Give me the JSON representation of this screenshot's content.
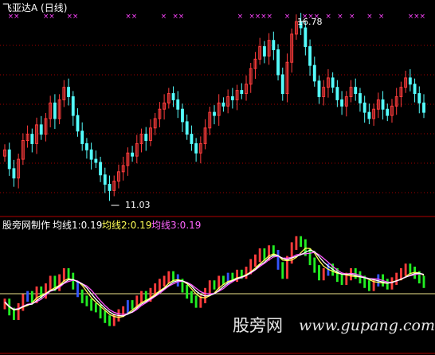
{
  "title": "飞亚达A (日线)",
  "indicator": {
    "name": "股旁网制作",
    "ma1": "均线1:0.19",
    "ma2": "均线2:0.19",
    "ma3": "均线3:0.19"
  },
  "annotations": {
    "high": "16.78",
    "low": "11.03"
  },
  "watermark": {
    "text": "股旁网",
    "url": "www.gupang.com"
  },
  "colors": {
    "background": "#000000",
    "up": "#ff3c3c",
    "down": "#54fcfc",
    "grid": "#a00000",
    "ma1": "#ffffff",
    "ma2": "#ffff55",
    "ma3": "#ff55ff",
    "baseline": "#f0e68c",
    "osc_green": "#22ee22",
    "osc_blue": "#3355ff",
    "marker": "#ff44ff"
  },
  "chart_data": {
    "type": "candlestick",
    "price_range": [
      11.03,
      16.78
    ],
    "close": [
      12.6,
      12.0,
      11.7,
      12.3,
      12.9,
      13.1,
      12.8,
      13.4,
      13.1,
      13.6,
      14.1,
      13.6,
      14.2,
      14.6,
      14.3,
      13.7,
      13.2,
      12.8,
      12.6,
      12.3,
      12.2,
      11.8,
      11.5,
      11.3,
      11.6,
      11.9,
      12.1,
      12.5,
      12.4,
      12.8,
      13.1,
      12.9,
      13.3,
      13.6,
      13.9,
      14.1,
      14.4,
      14.2,
      13.9,
      13.5,
      13.1,
      12.8,
      12.5,
      12.8,
      13.3,
      13.8,
      13.7,
      14.1,
      14.0,
      14.3,
      14.2,
      14.5,
      14.4,
      14.7,
      15.2,
      15.5,
      15.9,
      15.6,
      16.1,
      15.8,
      15.0,
      14.4,
      15.4,
      16.3,
      16.7,
      16.5,
      15.9,
      15.3,
      14.8,
      14.3,
      14.6,
      14.9,
      14.6,
      14.2,
      14.0,
      14.3,
      14.6,
      14.4,
      14.1,
      13.8,
      13.6,
      13.9,
      14.2,
      13.9,
      13.7,
      14.0,
      14.3,
      14.6,
      14.9,
      14.7,
      14.4,
      14.1,
      13.8
    ],
    "open": [
      12.4,
      12.6,
      12.0,
      11.7,
      12.3,
      12.9,
      13.1,
      12.8,
      13.4,
      13.1,
      13.6,
      14.1,
      13.6,
      14.2,
      14.6,
      14.3,
      13.7,
      13.2,
      12.8,
      12.6,
      12.3,
      12.2,
      11.8,
      11.5,
      11.3,
      11.6,
      11.9,
      12.1,
      12.5,
      12.4,
      12.8,
      13.1,
      12.9,
      13.3,
      13.6,
      13.9,
      14.1,
      14.4,
      14.2,
      13.9,
      13.5,
      13.1,
      12.8,
      12.5,
      12.8,
      13.3,
      13.8,
      13.7,
      14.1,
      14.0,
      14.3,
      14.2,
      14.5,
      14.4,
      14.7,
      15.2,
      15.5,
      15.9,
      15.6,
      16.1,
      15.8,
      15.0,
      14.4,
      15.4,
      16.3,
      16.7,
      16.5,
      15.9,
      15.3,
      14.8,
      14.3,
      14.6,
      14.9,
      14.6,
      14.2,
      14.0,
      14.3,
      14.6,
      14.4,
      14.1,
      13.8,
      13.6,
      13.9,
      14.2,
      13.9,
      13.7,
      14.0,
      14.3,
      14.6,
      14.9,
      14.7,
      14.4,
      14.1
    ],
    "sell_markers": [
      1,
      2,
      7,
      8,
      11,
      12,
      21,
      22,
      27,
      29,
      30,
      40,
      42,
      43,
      44,
      45,
      48,
      51,
      52,
      53,
      55,
      57,
      59,
      62,
      64,
      69,
      70,
      71
    ],
    "oscillator_baseline": 0
  }
}
